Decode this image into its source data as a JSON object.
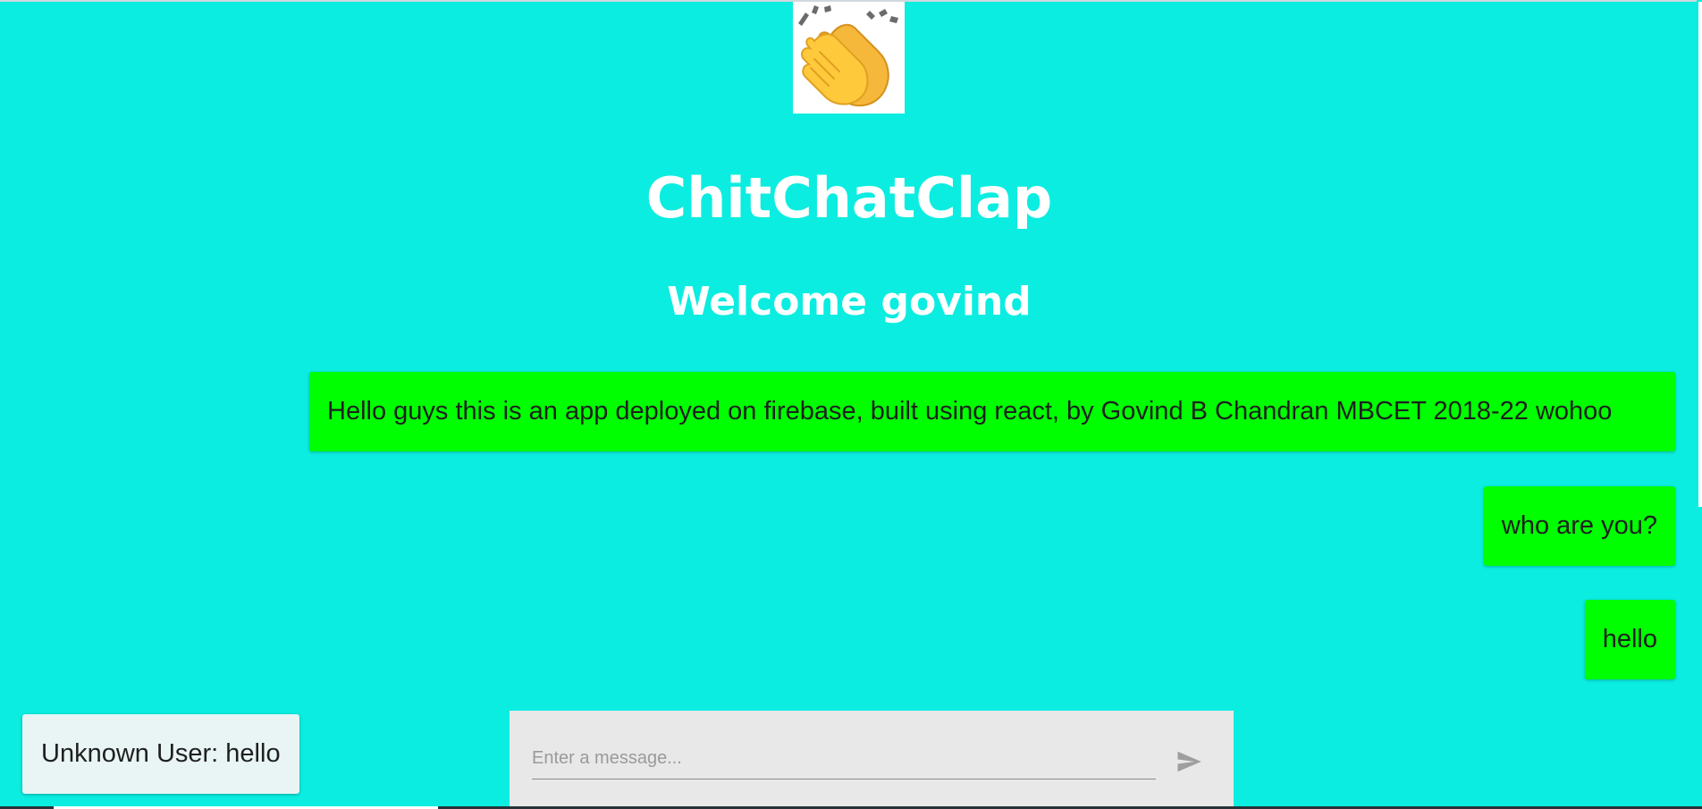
{
  "app": {
    "title": "ChitChatClap",
    "welcome": "Welcome govind",
    "logo_icon": "clapping-hands-icon"
  },
  "messages": [
    {
      "author": "self",
      "text": "Hello guys this is an app deployed on firebase, built using react, by Govind B Chandran MBCET 2018-22 wohoo"
    },
    {
      "author": "self",
      "text": "who are you?"
    },
    {
      "author": "self",
      "text": "hello"
    },
    {
      "author": "other",
      "text": "Unknown User: hello"
    }
  ],
  "composer": {
    "placeholder": "Enter a message...",
    "value": "",
    "send_icon": "send-icon"
  },
  "colors": {
    "background": "#0bede0",
    "own_message": "#00ff00",
    "other_message": "#e8f5f4",
    "composer": "#e8e8e8",
    "heading": "#ffffff"
  }
}
